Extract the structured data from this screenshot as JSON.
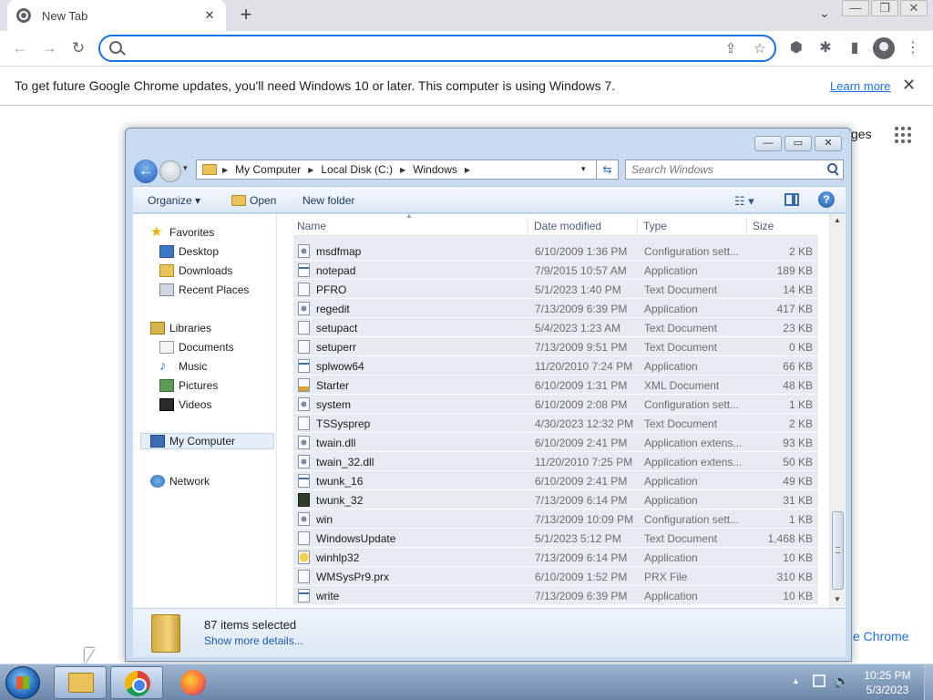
{
  "browser": {
    "tab_title": "New Tab",
    "tab_close": "✕",
    "new_tab": "+",
    "tab_search": "⌄",
    "window_controls": [
      "—",
      "❐",
      "✕"
    ],
    "back": "←",
    "forward": "→",
    "reload": "↻",
    "omnibox_value": "",
    "share_icon": "⇪",
    "bookmark_icon": "☆",
    "toolbar_icons": [
      "⬢",
      "✱",
      "▮",
      "⋮"
    ],
    "infobar": {
      "message": "To get future Google Chrome updates, you'll need Windows 10 or later. This computer is using Windows 7.",
      "link": "Learn more",
      "close": "✕"
    },
    "page_partial_texts": [
      "ges",
      "e Chrome"
    ]
  },
  "explorer": {
    "window_controls": [
      "—",
      "▭",
      "✕"
    ],
    "back": "←",
    "hist": "▾",
    "address": {
      "crumbs": [
        "My Computer",
        "Local Disk (C:)",
        "Windows"
      ],
      "sep": "▶",
      "drop": "▾"
    },
    "refresh": "⇆",
    "search_placeholder": "Search Windows",
    "commands": {
      "organize": "Organize ▾",
      "open": "Open",
      "new_folder": "New folder",
      "views": "☷ ▾",
      "help": "?"
    },
    "nav": {
      "favorites": "Favorites",
      "desktop": "Desktop",
      "downloads": "Downloads",
      "recent_places": "Recent Places",
      "libraries": "Libraries",
      "documents": "Documents",
      "music": "Music",
      "pictures": "Pictures",
      "videos": "Videos",
      "my_computer": "My Computer",
      "network": "Network",
      "star": "★",
      "note": "♪"
    },
    "columns": {
      "name": "Name",
      "date": "Date modified",
      "type": "Type",
      "size": "Size",
      "sort": "▲"
    },
    "files": [
      {
        "name": "msdfmap",
        "date": "6/10/2009 1:36 PM",
        "type": "Configuration sett...",
        "size": "2 KB",
        "icon": "cfg"
      },
      {
        "name": "notepad",
        "date": "7/9/2015 10:57 AM",
        "type": "Application",
        "size": "189 KB",
        "icon": "app"
      },
      {
        "name": "PFRO",
        "date": "5/1/2023 1:40 PM",
        "type": "Text Document",
        "size": "14 KB",
        "icon": "txt"
      },
      {
        "name": "regedit",
        "date": "7/13/2009 6:39 PM",
        "type": "Application",
        "size": "417 KB",
        "icon": "cfg"
      },
      {
        "name": "setupact",
        "date": "5/4/2023 1:23 AM",
        "type": "Text Document",
        "size": "23 KB",
        "icon": "txt"
      },
      {
        "name": "setuperr",
        "date": "7/13/2009 9:51 PM",
        "type": "Text Document",
        "size": "0 KB",
        "icon": "txt"
      },
      {
        "name": "splwow64",
        "date": "11/20/2010 7:24 PM",
        "type": "Application",
        "size": "66 KB",
        "icon": "app"
      },
      {
        "name": "Starter",
        "date": "6/10/2009 1:31 PM",
        "type": "XML Document",
        "size": "48 KB",
        "icon": "xml"
      },
      {
        "name": "system",
        "date": "6/10/2009 2:08 PM",
        "type": "Configuration sett...",
        "size": "1 KB",
        "icon": "cfg"
      },
      {
        "name": "TSSysprep",
        "date": "4/30/2023 12:32 PM",
        "type": "Text Document",
        "size": "2 KB",
        "icon": "txt"
      },
      {
        "name": "twain.dll",
        "date": "6/10/2009 2:41 PM",
        "type": "Application extens...",
        "size": "93 KB",
        "icon": "cfg"
      },
      {
        "name": "twain_32.dll",
        "date": "11/20/2010 7:25 PM",
        "type": "Application extens...",
        "size": "50 KB",
        "icon": "cfg"
      },
      {
        "name": "twunk_16",
        "date": "6/10/2009 2:41 PM",
        "type": "Application",
        "size": "49 KB",
        "icon": "app"
      },
      {
        "name": "twunk_32",
        "date": "7/13/2009 6:14 PM",
        "type": "Application",
        "size": "31 KB",
        "icon": "dark"
      },
      {
        "name": "win",
        "date": "7/13/2009 10:09 PM",
        "type": "Configuration sett...",
        "size": "1 KB",
        "icon": "cfg"
      },
      {
        "name": "WindowsUpdate",
        "date": "5/1/2023 5:12 PM",
        "type": "Text Document",
        "size": "1,468 KB",
        "icon": "txt"
      },
      {
        "name": "winhlp32",
        "date": "7/13/2009 6:14 PM",
        "type": "Application",
        "size": "10 KB",
        "icon": "help"
      },
      {
        "name": "WMSysPr9.prx",
        "date": "6/10/2009 1:52 PM",
        "type": "PRX File",
        "size": "310 KB",
        "icon": "txt"
      },
      {
        "name": "write",
        "date": "7/13/2009 6:39 PM",
        "type": "Application",
        "size": "10 KB",
        "icon": "app"
      }
    ],
    "scroll_up": "▲",
    "scroll_down": "▼",
    "details": {
      "count": "87 items selected",
      "more": "Show more details..."
    }
  },
  "taskbar": {
    "tray_arrow": "▲",
    "volume": "🔈",
    "time": "10:25 PM",
    "date": "5/3/2023"
  }
}
